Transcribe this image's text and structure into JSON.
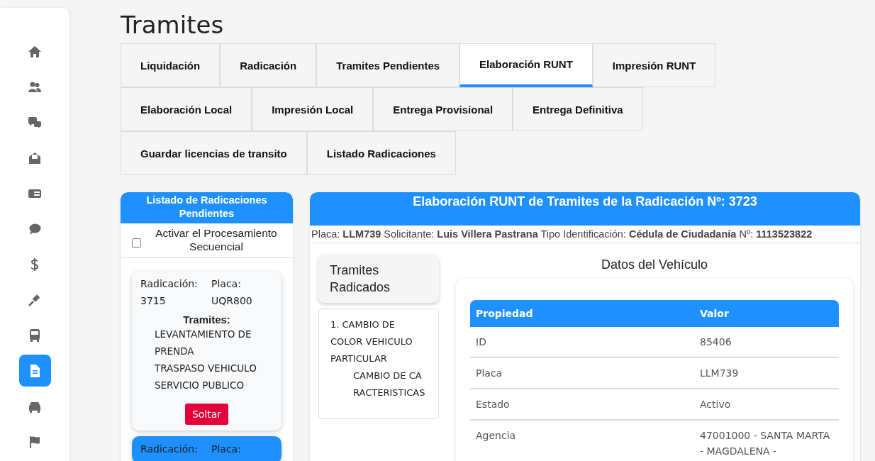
{
  "sidebar": {
    "items": [
      {
        "selected": false
      },
      {
        "selected": false
      },
      {
        "selected": false
      },
      {
        "selected": false
      },
      {
        "selected": false
      },
      {
        "selected": false
      },
      {
        "selected": false
      },
      {
        "selected": false
      },
      {
        "selected": false
      },
      {
        "selected": true
      },
      {
        "selected": false
      },
      {
        "selected": false
      }
    ]
  },
  "title": "Tramites",
  "tabs": [
    {
      "label": "Liquidación",
      "selected": false
    },
    {
      "label": "Radicación",
      "selected": false
    },
    {
      "label": "Tramites Pendientes",
      "selected": false
    },
    {
      "label": "Elaboración RUNT",
      "selected": true
    },
    {
      "label": "Impresión RUNT",
      "selected": false
    },
    {
      "label": "Elaboración Local",
      "selected": false
    },
    {
      "label": "Impresión Local",
      "selected": false
    },
    {
      "label": "Entrega Provisional",
      "selected": false
    },
    {
      "label": "Entrega Definitiva",
      "selected": false
    },
    {
      "label": "Guardar licencias de transito",
      "selected": false
    },
    {
      "label": "Listado Radicaciones",
      "selected": false
    }
  ],
  "pending": {
    "title": "Listado de Radicaciones Pendientes",
    "sequential": {
      "label": "Activar el Procesamiento Secuencial",
      "checked": false
    },
    "cards": [
      {
        "selected": false,
        "radicacion_label": "Radicación:",
        "radicacion": "3715",
        "placa_label": "Placa:",
        "placa": "UQR800",
        "tramites_label": "Tramites:",
        "tramites": [
          "LEVANTAMIENTO DE PRENDA",
          "TRASPASO VEHICULO SERVICIO PUBLICO"
        ],
        "button": "Soltar"
      },
      {
        "selected": true,
        "radicacion_label": "Radicación:",
        "placa_label": "Placa:"
      }
    ]
  },
  "detail": {
    "title": "Elaboración RUNT de Tramites de la Radicación Nº: 3723",
    "info": "Placa: **LLM739** Solicitante: **Luis Villera Pastrana** Tipo Identificación: **Cédula de Ciudadanía** Nº: **1113523822**",
    "tramites_title": "Tramites Radicados",
    "tramites": [
      "1. CAMBIO DE COLOR VEHICULO PARTICULAR",
      "CAMBIO DE CARACTERISTICAS"
    ],
    "vehicle_title": "Datos del Vehículo",
    "table": {
      "columns": [
        "Propiedad",
        "Valor"
      ],
      "rows": [
        [
          "ID",
          "85406"
        ],
        [
          "Placa",
          "LLM739"
        ],
        [
          "Estado",
          "Activo"
        ],
        [
          "Agencia",
          "47001000 - SANTA MARTA - MAGDALENA -"
        ]
      ]
    }
  }
}
